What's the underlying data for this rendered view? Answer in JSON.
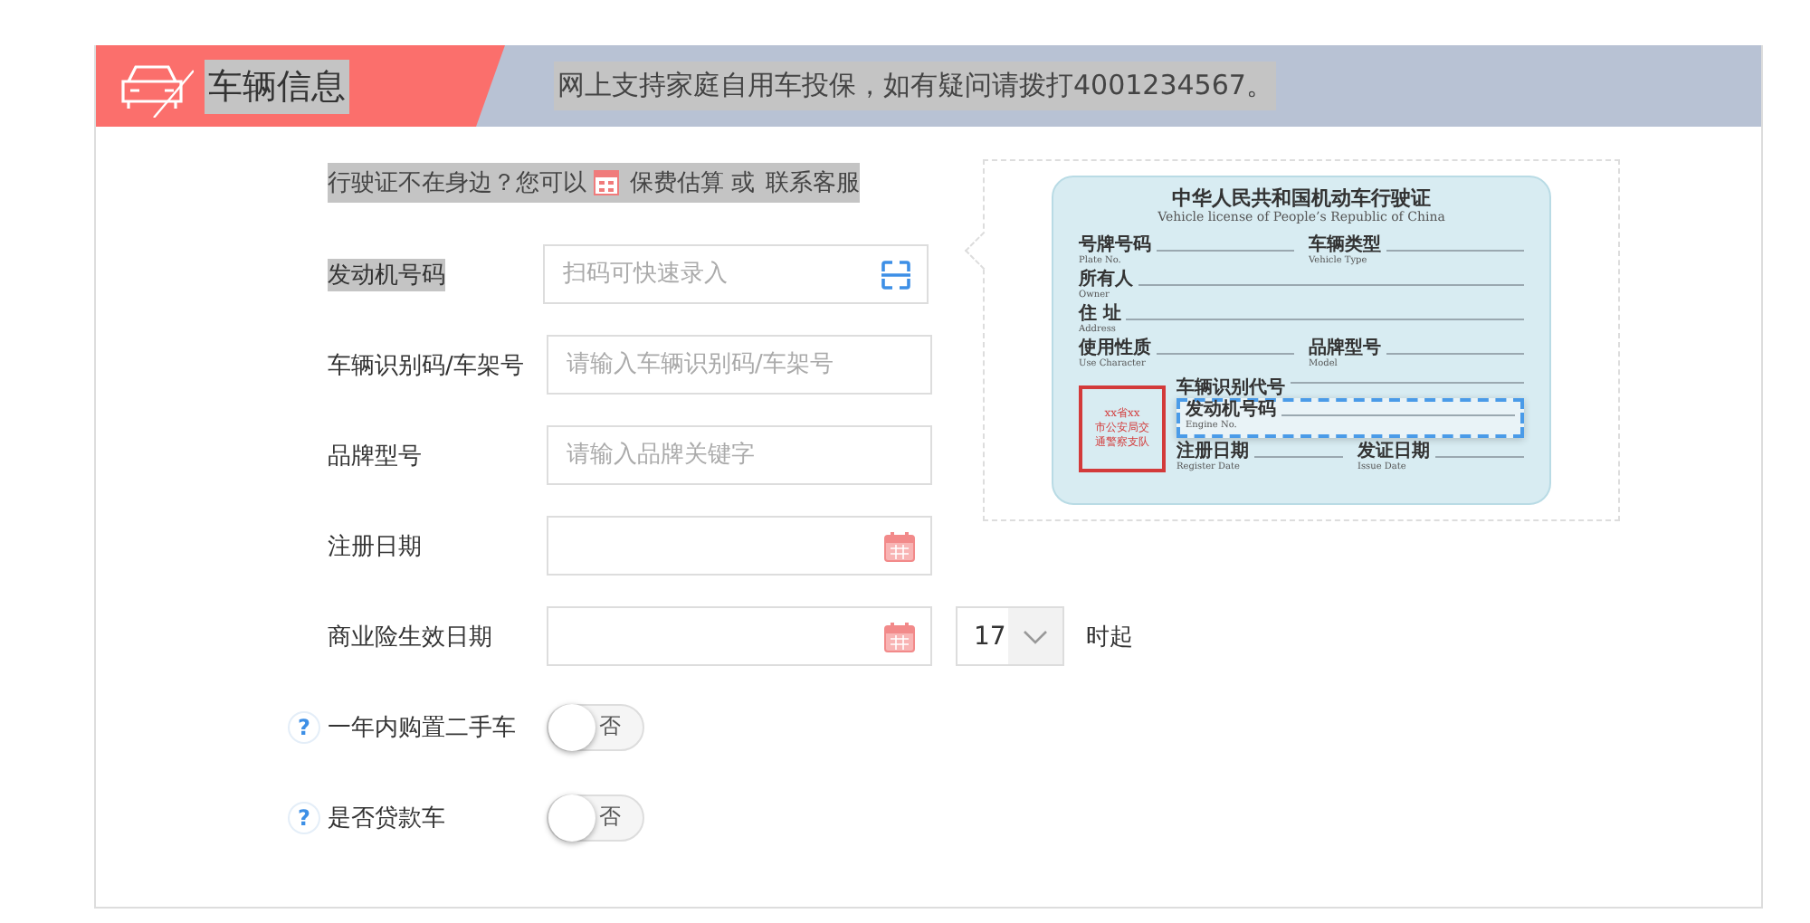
{
  "header": {
    "title": {
      "text": "车辆信息",
      "highlighted": true
    },
    "notice": {
      "text": "网上支持家庭自用车投保，如有疑问请拨打4001234567。",
      "highlighted": true
    }
  },
  "hint": {
    "prefix": "行驶证不在身边？您可以",
    "link": "保费估算",
    "separator": "或",
    "contact": "联系客服",
    "highlighted": true
  },
  "fields": [
    {
      "kind": "scan",
      "label": "发动机号码",
      "placeholder": "扫码可快速录入",
      "highlighted": true
    },
    {
      "kind": "text",
      "label": "车辆识别码/车架号",
      "placeholder": "请输入车辆识别码/车架号",
      "highlighted": false
    },
    {
      "kind": "text",
      "label": "品牌型号",
      "placeholder": "请输入品牌关键字",
      "highlighted": false
    },
    {
      "kind": "date",
      "label": "注册日期",
      "highlighted": false
    },
    {
      "kind": "date-hour",
      "label": "商业险生效日期",
      "hour": "17",
      "suffix": "时起",
      "highlighted": false
    },
    {
      "kind": "toggle",
      "label": "一年内购置二手车",
      "help": "?",
      "on": false,
      "value_text": "否",
      "highlighted": false
    },
    {
      "kind": "toggle",
      "label": "是否贷款车",
      "help": "?",
      "on": false,
      "value_text": "否",
      "highlighted": false
    }
  ],
  "license": {
    "title": "中华人民共和国机动车行驶证",
    "subtitle": "Vehicle license of People’s Republic of China",
    "rows": [
      [
        {
          "zh": "号牌号码",
          "en": "Plate No."
        },
        {
          "zh": "车辆类型",
          "en": "Vehicle Type"
        }
      ],
      [
        {
          "zh": "所有人",
          "en": "Owner"
        }
      ],
      [
        {
          "zh": "住 址",
          "en": "Address"
        }
      ],
      [
        {
          "zh": "使用性质",
          "en": "Use Character"
        },
        {
          "zh": "品牌型号",
          "en": "Model"
        }
      ]
    ],
    "vin": {
      "zh": "车辆识别代号"
    },
    "engine": {
      "zh": "发动机号码",
      "en": "Engine No.",
      "highlighted": true
    },
    "dates": [
      {
        "zh": "注册日期",
        "en": "Register Date"
      },
      {
        "zh": "发证日期",
        "en": "Issue Date"
      }
    ],
    "stamp": [
      "xx省xx",
      "市公安局交",
      "通警察支队"
    ]
  }
}
